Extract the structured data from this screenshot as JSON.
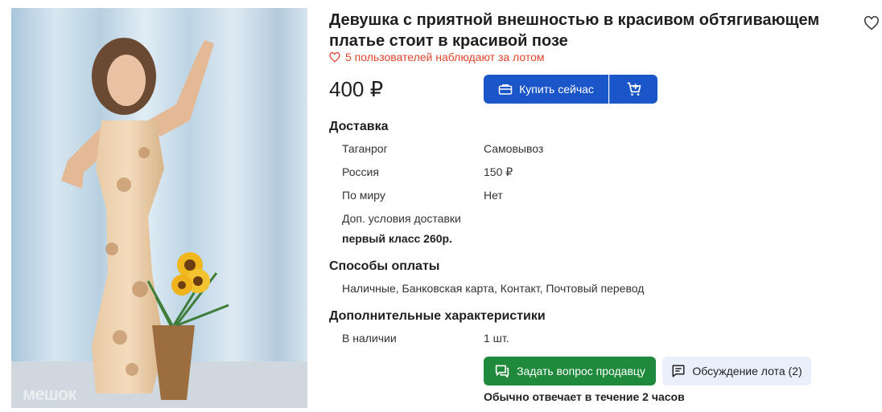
{
  "lot": {
    "title": "Девушка с приятной внешностью в красивом обтягивающем платье стоит в красивой позе",
    "watchers": "5 пользователей наблюдают за лотом",
    "price": "400 ₽",
    "watermark": "мешок"
  },
  "actions": {
    "buy_now": "Купить сейчас",
    "ask_seller": "Задать вопрос продавцу",
    "discussion": "Обсуждение лота (2)",
    "reply_note": "Обычно отвечает в течение 2 часов"
  },
  "delivery": {
    "heading": "Доставка",
    "rows": [
      {
        "label": "Таганрог",
        "value": "Самовывоз"
      },
      {
        "label": "Россия",
        "value": "150 ₽"
      },
      {
        "label": "По миру",
        "value": "Нет"
      }
    ],
    "extra_label": "Доп. условия доставки",
    "extra_value": "первый класс 260р."
  },
  "payment": {
    "heading": "Способы оплаты",
    "methods": "Наличные, Банковская карта, Контакт, Почтовый перевод"
  },
  "characteristics": {
    "heading": "Дополнительные характеристики",
    "rows": [
      {
        "label": "В наличии",
        "value": "1 шт."
      }
    ]
  },
  "colors": {
    "primary": "#1a56c8",
    "success": "#1f8a3b",
    "accent_red": "#e0452c",
    "secondary_bg": "#eaf0fb"
  },
  "icons": {
    "favorite": "heart-outline-icon",
    "watchers": "heart-outline-icon",
    "buy": "briefcase-icon",
    "cart": "cart-plus-icon",
    "ask": "chat-icon",
    "discussion": "comment-icon"
  }
}
